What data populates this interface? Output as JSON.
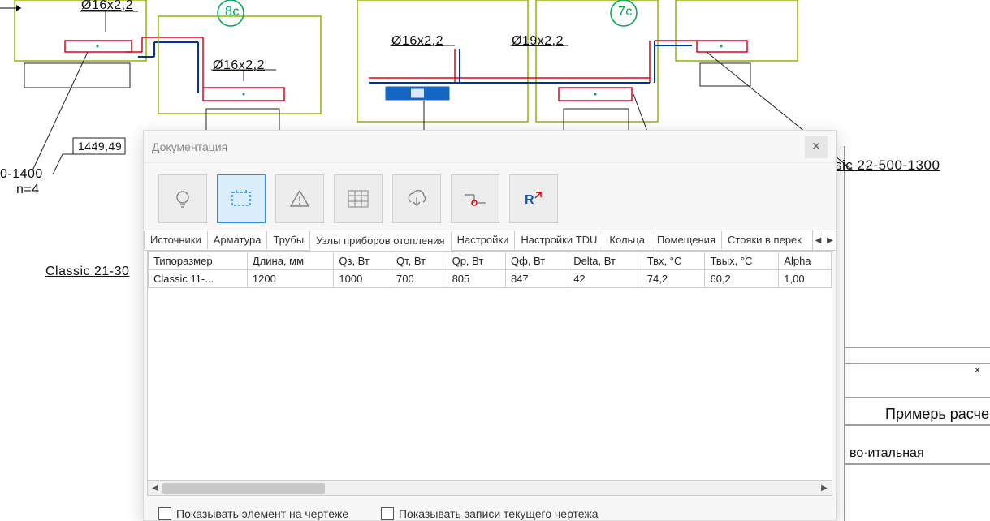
{
  "cad": {
    "dim1": "Ø16x2,2",
    "dim1b": "Ø16x2,2",
    "dim2": "Ø16x2,2",
    "dim3": "Ø16x2,2",
    "dim4": "Ø19x2,2",
    "node8": "8c",
    "node7": "7c",
    "tag_height": "1449,49",
    "left_range": "0-1400",
    "left_n": "n=4",
    "left_classic": "Classic 21-30",
    "right_classic": "sic 22-500-1300",
    "right_block1": "Примерь расче",
    "right_block2": "во·итальная"
  },
  "dialog": {
    "title": "Документация",
    "toolbar_icons": [
      "lightbulb-icon",
      "selection-icon",
      "warning-icon",
      "table-icon",
      "cloud-download-icon",
      "link-pipe-icon",
      "revit-export-icon"
    ],
    "tabs": [
      "Источники",
      "Арматура",
      "Трубы",
      "Узлы приборов отопления",
      "Настройки",
      "Настройки TDU",
      "Кольца",
      "Помещения",
      "Стояки в перек"
    ],
    "active_tab_index": 3,
    "columns": [
      "Типоразмер",
      "Длина, мм",
      "Qз, Вт",
      "Qт, Вт",
      "Qр, Вт",
      "Qф, Вт",
      "Delta, Вт",
      "Твх, °C",
      "Твых, °C",
      "Alpha"
    ],
    "row": [
      "Classic 11-...",
      "1200",
      "1000",
      "700",
      "805",
      "847",
      "42",
      "74,2",
      "60,2",
      "1,00"
    ],
    "cb1_label": "Показывать элемент на чертеже",
    "cb2_label": "Показывать записи текущего чертежа"
  },
  "chart_data": null
}
